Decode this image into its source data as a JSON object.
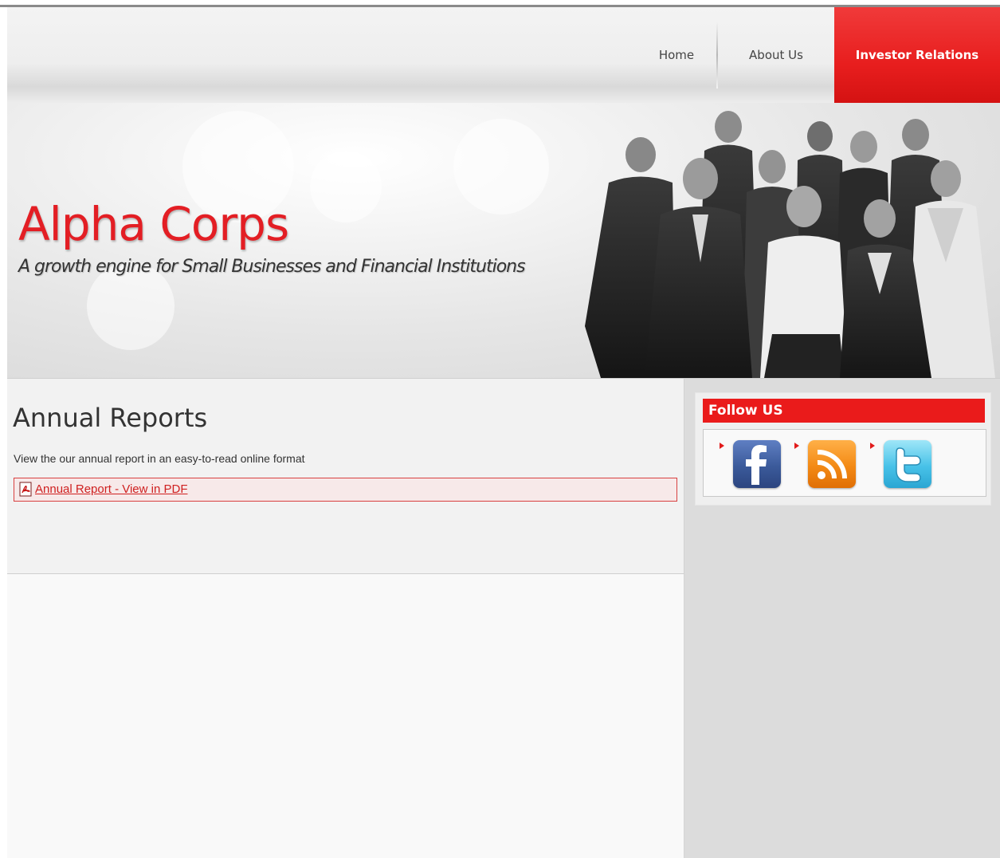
{
  "nav": {
    "items": [
      {
        "label": "Home"
      },
      {
        "label": "About Us"
      },
      {
        "label": "Investor Relations",
        "active": true
      }
    ]
  },
  "banner": {
    "brand": "Alpha Corps",
    "tagline": "A growth engine for Small Businesses and Financial Institutions"
  },
  "main": {
    "heading": "Annual Reports",
    "description": "View the our annual report in an easy-to-read online format",
    "report_link": "Annual Report - View in PDF"
  },
  "sidebar": {
    "follow_title": "Follow US",
    "social": [
      {
        "icon": "facebook-icon"
      },
      {
        "icon": "rss-icon"
      },
      {
        "icon": "twitter-icon"
      }
    ]
  },
  "colors": {
    "accent": "#e81e1e",
    "link": "#cf2020",
    "text": "#333333"
  }
}
